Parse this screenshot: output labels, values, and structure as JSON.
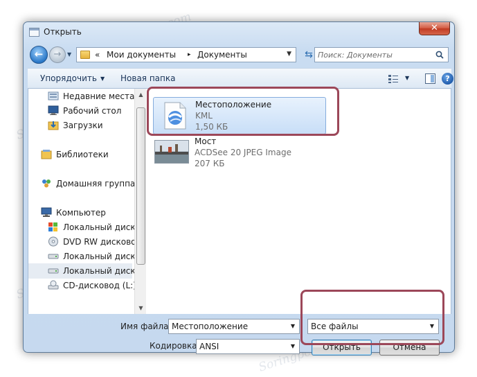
{
  "window": {
    "title": "Открыть",
    "close_glyph": "✕"
  },
  "address": {
    "crumbs": [
      "Мои документы",
      "Документы"
    ],
    "separator_left": "«",
    "separator_mid": "▸",
    "search_placeholder": "Поиск: Документы"
  },
  "toolbar": {
    "organize": "Упорядочить",
    "new_folder": "Новая папка",
    "help_glyph": "?"
  },
  "nav": {
    "items": [
      {
        "label": "Недавние места",
        "icon": "recent-places-icon"
      },
      {
        "label": "Рабочий стол",
        "icon": "desktop-icon"
      },
      {
        "label": "Загрузки",
        "icon": "downloads-icon"
      },
      {
        "label": "Библиотеки",
        "icon": "libraries-icon"
      },
      {
        "label": "Домашняя группа",
        "icon": "homegroup-icon"
      },
      {
        "label": "Компьютер",
        "icon": "computer-icon"
      },
      {
        "label": "Локальный диск (",
        "icon": "local-disk-icon"
      },
      {
        "label": "DVD RW дисковод",
        "icon": "dvd-drive-icon"
      },
      {
        "label": "Локальный диск (",
        "icon": "local-disk-icon"
      },
      {
        "label": "CD-дисковод (L:)",
        "icon": "cd-drive-icon"
      }
    ]
  },
  "files": [
    {
      "name": "Местоположение",
      "type": "KML",
      "size": "1,50 КБ",
      "icon": "kml-file-icon"
    },
    {
      "name": "Мост",
      "type": "ACDSee 20 JPEG Image",
      "size": "207 КБ",
      "icon": "jpeg-thumbnail-icon"
    }
  ],
  "bottom": {
    "filename_label": "Имя файла:",
    "filename_value": "Местоположение",
    "encoding_label": "Кодировка:",
    "encoding_value": "ANSI",
    "filter_value": "Все файлы",
    "open_button": "Открыть",
    "cancel_button": "Отмена"
  },
  "watermark": "Soringpcrepair.com",
  "colors": {
    "highlight_box": "#9c4759",
    "selection": "#c8def7",
    "frame": "#c6d9ef"
  }
}
